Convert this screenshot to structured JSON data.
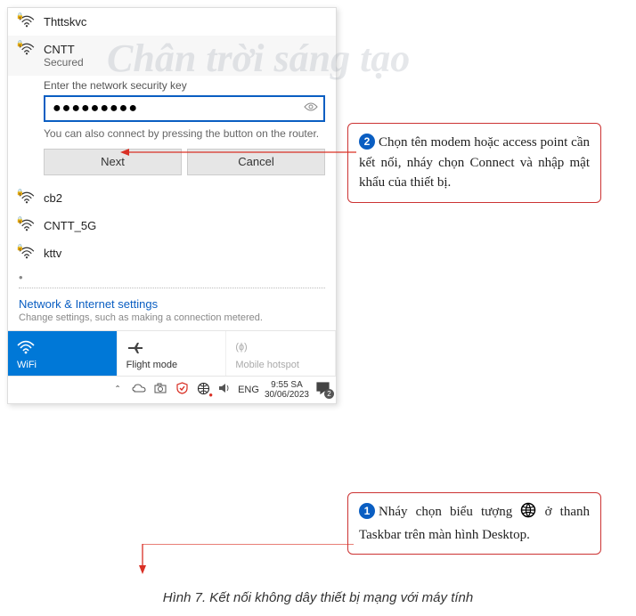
{
  "watermark": "Chân trời sáng tạo",
  "networks": {
    "n0": {
      "name": "Thttskvc"
    },
    "active": {
      "name": "CNTT",
      "status": "Secured"
    },
    "n2": {
      "name": "cb2"
    },
    "n3": {
      "name": "CNTT_5G"
    },
    "n4": {
      "name": "kttv"
    }
  },
  "connect": {
    "prompt": "Enter the network security key",
    "password_masked": "●●●●●●●●●",
    "hint": "You can also connect by pressing the button on the router.",
    "next": "Next",
    "cancel": "Cancel"
  },
  "settings": {
    "title": "Network & Internet settings",
    "sub": "Change settings, such as making a connection metered."
  },
  "tiles": {
    "wifi": "WiFi",
    "flight": "Flight mode",
    "hotspot_icon": "(ɸ)",
    "hotspot": "Mobile hotspot"
  },
  "taskbar": {
    "lang": "ENG",
    "time": "9:55 SA",
    "date": "30/06/2023",
    "notif_count": "2"
  },
  "callouts": {
    "c2_num": "2",
    "c2_text": "Chọn tên modem hoặc access point cần kết nối, nháy chọn Connect và nhập mật khẩu của thiết bị.",
    "c1_num": "1",
    "c1_text_a": "Nháy chọn biểu tượng ",
    "c1_text_b": " ở thanh Taskbar trên màn hình Desktop."
  },
  "caption": "Hình 7. Kết nối không dây thiết bị mạng với máy tính"
}
